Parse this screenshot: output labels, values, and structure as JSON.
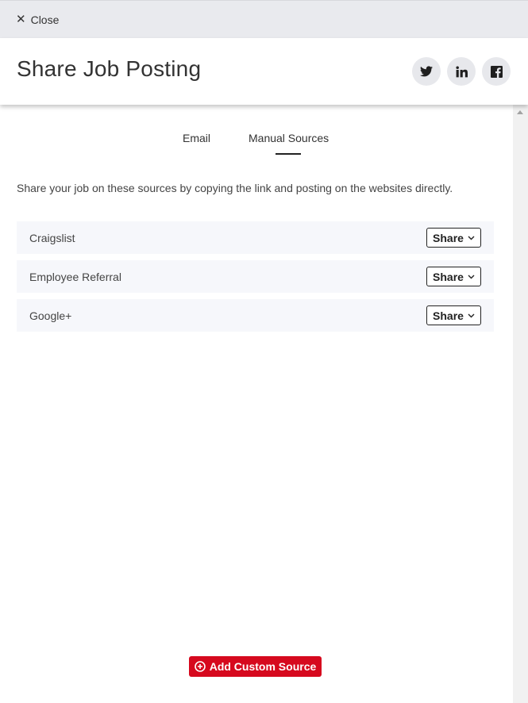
{
  "topbar": {
    "close_label": "Close"
  },
  "header": {
    "title": "Share Job Posting",
    "social": [
      "twitter-icon",
      "linkedin-icon",
      "facebook-icon"
    ]
  },
  "tabs": [
    {
      "label": "Email",
      "active": false
    },
    {
      "label": "Manual Sources",
      "active": true
    }
  ],
  "description": "Share your job on these sources by copying the link and posting on the websites directly.",
  "sources": [
    {
      "name": "Craigslist",
      "action": "Share"
    },
    {
      "name": "Employee Referral",
      "action": "Share"
    },
    {
      "name": "Google+",
      "action": "Share"
    }
  ],
  "add_source_label": "Add Custom Source",
  "colors": {
    "accent": "#d6091e",
    "topbar_bg": "#e9eaee",
    "row_bg": "#f6f7fb",
    "social_bg": "#e7e8ec"
  }
}
